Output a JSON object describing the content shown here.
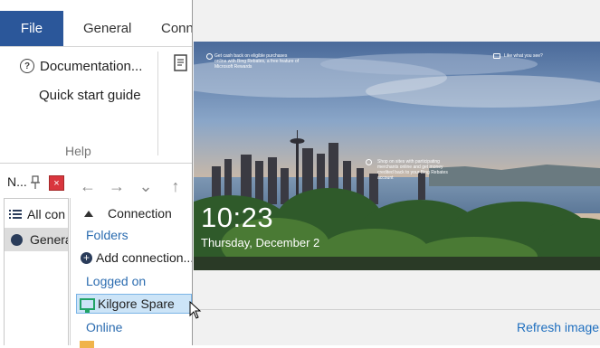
{
  "ribbon": {
    "tabs": [
      "File",
      "General",
      "Conn"
    ],
    "documentation_label": "Documentation...",
    "quick_start_label": "Quick start guide",
    "group_label": "Help"
  },
  "left_panel": {
    "title": "N...",
    "close_glyph": "×",
    "items": [
      "All con",
      "Genera"
    ]
  },
  "nav": {
    "back": "←",
    "forward": "→",
    "down": "⌄",
    "up": "↑"
  },
  "tree": {
    "header": "Connection",
    "folders_label": "Folders",
    "add_connection_label": "Add connection...",
    "logged_on_label": "Logged on",
    "selected_machine": "Kilgore Spare",
    "online_label": "Online"
  },
  "preview": {
    "time": "10:23",
    "date": "Thursday, December 2",
    "tip_1": "Get cash back on eligible purchases online with Bing Rebates, a free feature of Microsoft Rewards",
    "tip_2": "Like what you see?",
    "tip_3": "Shop on sites with participating merchants online and get money credited back to your Bing Rebates account",
    "refresh_label": "Refresh image"
  },
  "colors": {
    "file_tab": "#2b579a",
    "section_text": "#2b6cb0",
    "selection": "#cce4f7",
    "link": "#1f6fbf"
  },
  "icons": [
    "question-icon",
    "document-icon",
    "pin-icon",
    "close-icon",
    "list-icon",
    "circle-icon",
    "back-arrow-icon",
    "forward-arrow-icon",
    "chevron-down-icon",
    "up-arrow-icon",
    "collapse-triangle-icon",
    "add-icon",
    "monitor-icon",
    "mouse-cursor-icon"
  ]
}
